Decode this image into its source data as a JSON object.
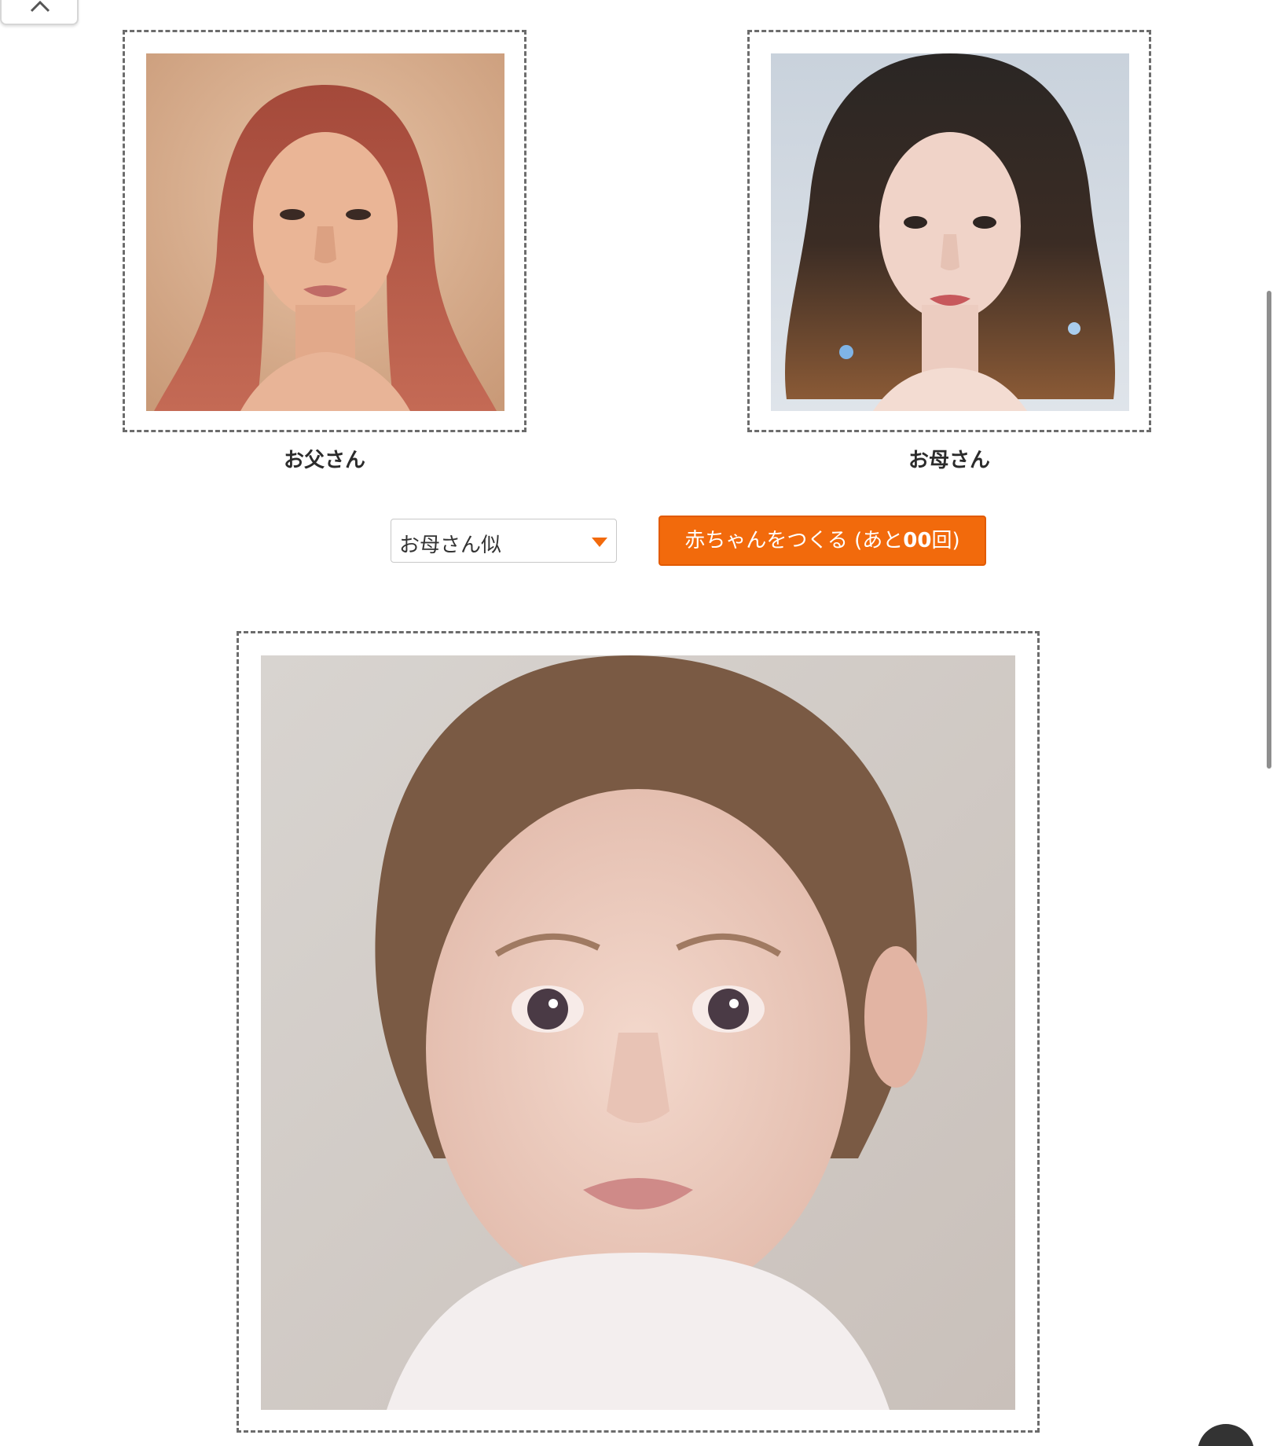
{
  "parents": {
    "father_label": "お父さん",
    "mother_label": "お母さん"
  },
  "controls": {
    "resemblance_select_value": "お母さん似",
    "make_button_prefix": "赤ちゃんをつくる (あと",
    "make_button_count": "00",
    "make_button_suffix": "回)"
  },
  "colors": {
    "accent": "#f26a0c",
    "frame_border": "#6c6c6c",
    "label_text": "#2b2b2b"
  },
  "icons": {
    "collapse": "chevron-up-icon",
    "dropdown": "caret-down-icon"
  }
}
